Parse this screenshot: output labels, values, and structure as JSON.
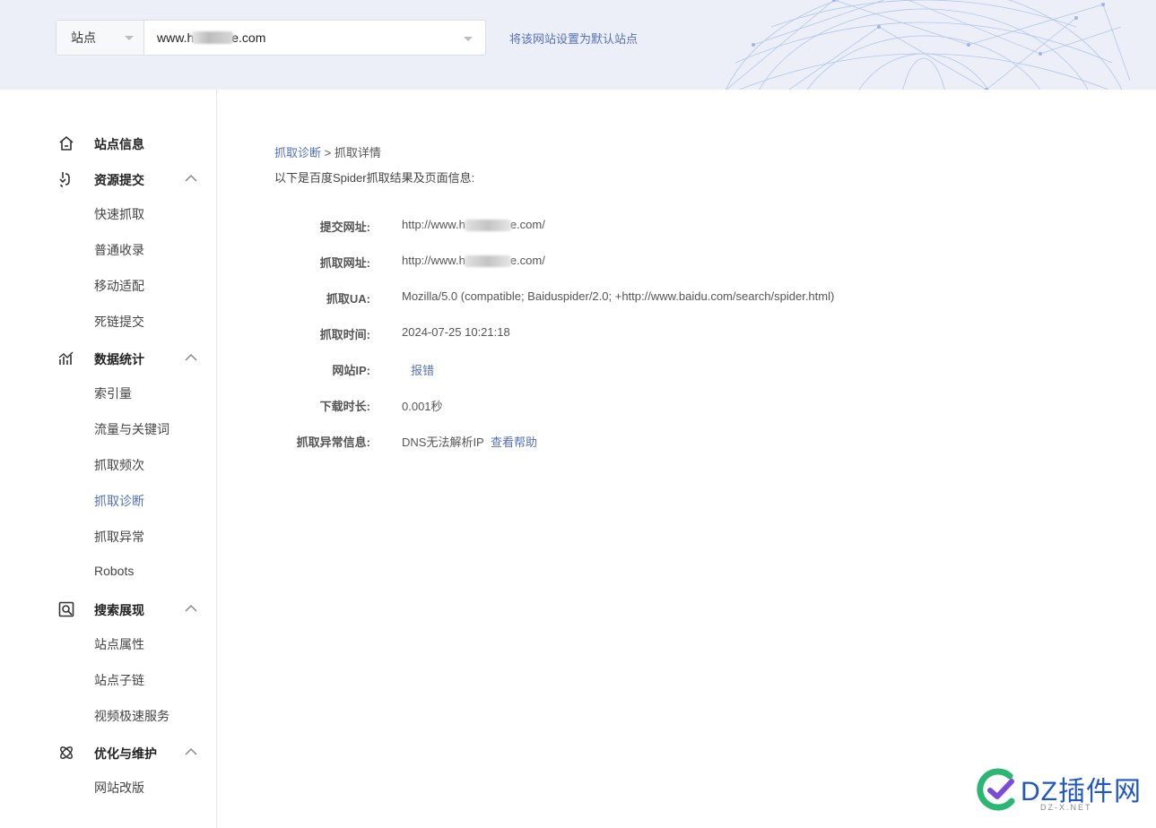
{
  "header": {
    "site_picker": {
      "type_label": "站点",
      "url_prefix": "www.h",
      "url_suffix": "e.com"
    },
    "default_link": "将该网站设置为默认站点"
  },
  "sidebar": {
    "groups": [
      {
        "label": "站点信息",
        "icon": "home-icon",
        "items": []
      },
      {
        "label": "资源提交",
        "icon": "link-submit-icon",
        "items": [
          "快速抓取",
          "普通收录",
          "移动适配",
          "死链提交"
        ]
      },
      {
        "label": "数据统计",
        "icon": "stats-icon",
        "items": [
          "索引量",
          "流量与关键词",
          "抓取频次",
          "抓取诊断",
          "抓取异常",
          "Robots"
        ]
      },
      {
        "label": "搜索展现",
        "icon": "search-display-icon",
        "items": [
          "站点属性",
          "站点子链",
          "视频极速服务"
        ]
      },
      {
        "label": "优化与维护",
        "icon": "optimize-icon",
        "items": [
          "网站改版"
        ]
      }
    ],
    "active_item": "抓取诊断"
  },
  "main": {
    "breadcrumb": {
      "link": "抓取诊断",
      "separator": ">",
      "current": "抓取详情"
    },
    "intro": "以下是百度Spider抓取结果及页面信息:",
    "details": {
      "submit_url": {
        "label": "提交网址:",
        "prefix": "http://www.h",
        "suffix": "e.com/"
      },
      "fetch_url": {
        "label": "抓取网址:",
        "prefix": "http://www.h",
        "suffix": "e.com/"
      },
      "ua": {
        "label": "抓取UA:",
        "value": "Mozilla/5.0 (compatible; Baiduspider/2.0; +http://www.baidu.com/search/spider.html)"
      },
      "time": {
        "label": "抓取时间:",
        "value": "2024-07-25 10:21:18"
      },
      "ip": {
        "label": "网站IP:",
        "link": "报错"
      },
      "duration": {
        "label": "下载时长:",
        "value": "0.001秒"
      },
      "error": {
        "label": "抓取异常信息:",
        "value": "DNS无法解析IP",
        "link": "查看帮助"
      }
    }
  },
  "watermark": {
    "text": "DZ插件网",
    "sub": "DZ-X.NET"
  },
  "colors": {
    "link": "#5470b8",
    "header_bg": "#eceff8",
    "watermark": "#1f57c8"
  }
}
